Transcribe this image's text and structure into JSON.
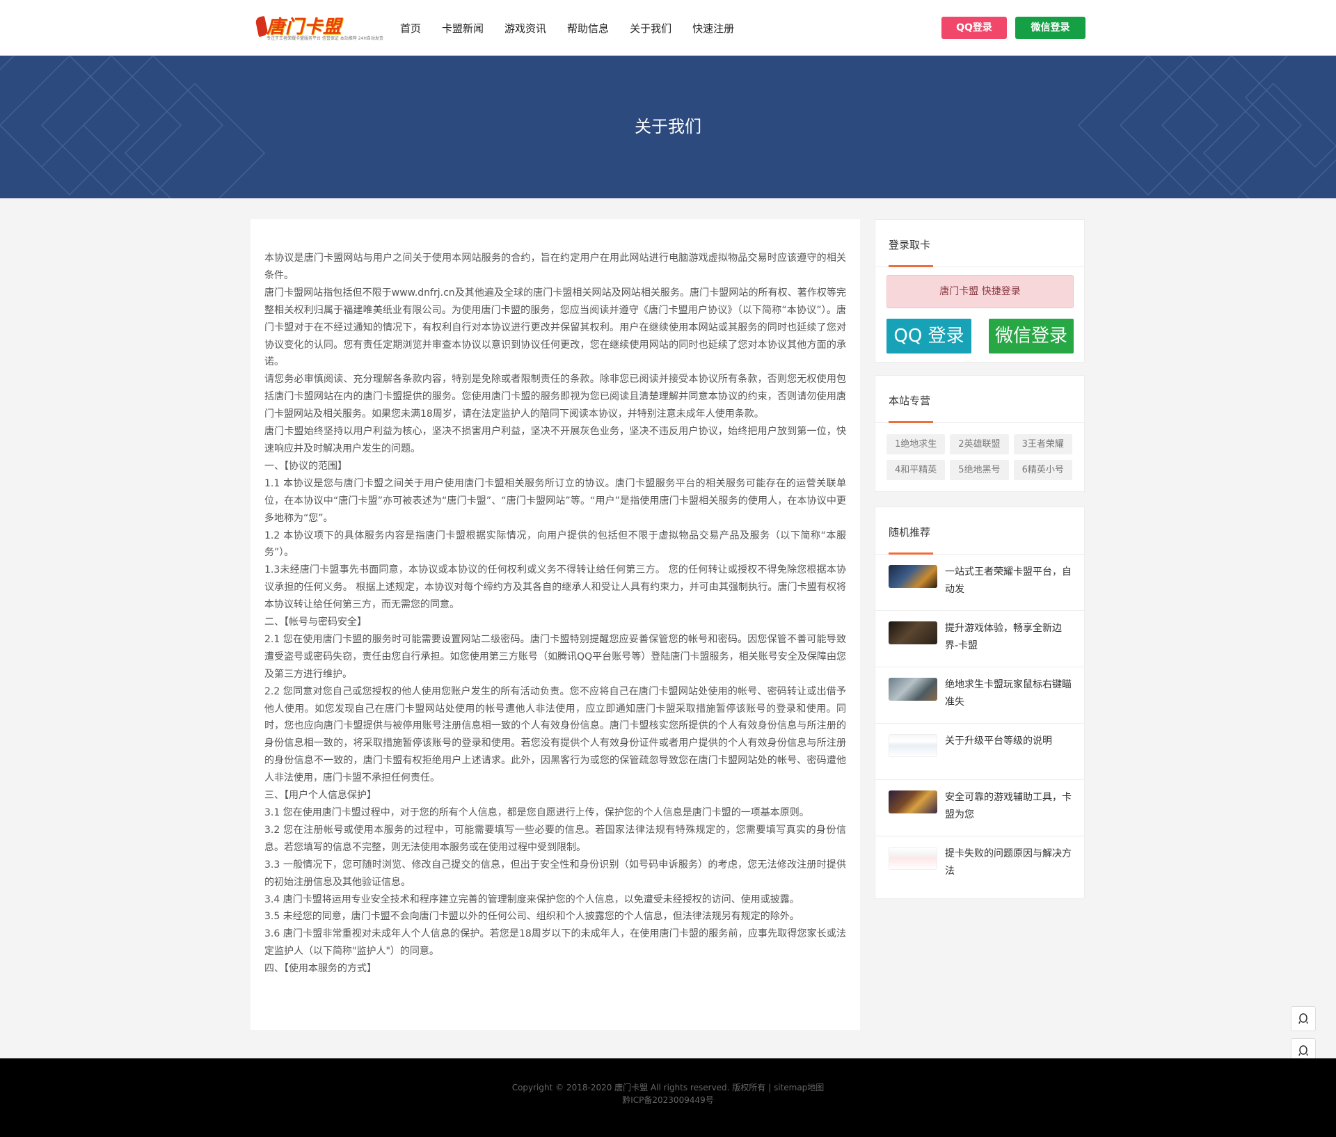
{
  "header": {
    "logo_text": "唐门卡盟",
    "logo_sub": "专注于王者荣耀卡盟服务平台 信誉保证 本站推荐 24H自动发货",
    "nav": [
      "首页",
      "卡盟新闻",
      "游戏资讯",
      "帮助信息",
      "关于我们",
      "快速注册"
    ],
    "qq_login": "QQ登录",
    "wechat_login": "微信登录"
  },
  "banner": {
    "title": "关于我们"
  },
  "article": {
    "paragraphs": [
      "本协议是唐门卡盟网站与用户之间关于使用本网站服务的合约，旨在约定用户在用此网站进行电脑游戏虚拟物品交易时应该遵守的相关条件。",
      "唐门卡盟网站指包括但不限于www.dnfrj.cn及其他遍及全球的唐门卡盟相关网站及网站相关服务。唐门卡盟网站的所有权、著作权等完整相关权利归属于福建唯美纸业有限公司。为使用唐门卡盟的服务，您应当阅读并遵守《唐门卡盟用户协议》（以下简称“本协议”）。唐门卡盟对于在不经过通知的情况下，有权利自行对本协议进行更改并保留其权利。用户在继续使用本网站或其服务的同时也延续了您对协议变化的认同。您有责任定期浏览并审查本协议以意识到协议任何更改，您在继续使用网站的同时也延续了您对本协议其他方面的承诺。",
      "请您务必审慎阅读、充分理解各条款内容，特别是免除或者限制责任的条款。除非您已阅读并接受本协议所有条款，否则您无权使用包括唐门卡盟网站在内的唐门卡盟提供的服务。您使用唐门卡盟的服务即视为您已阅读且清楚理解并同意本协议的约束，否则请勿使用唐门卡盟网站及相关服务。如果您未满18周岁，请在法定监护人的陪同下阅读本协议，并特别注意未成年人使用条款。",
      "唐门卡盟始终坚持以用户利益为核心，坚决不损害用户利益，坚决不开展灰色业务，坚决不违反用户协议，始终把用户放到第一位，快速响应并及时解决用户发生的问题。",
      "一、【协议的范围】",
      "1.1 本协议是您与唐门卡盟之间关于用户使用唐门卡盟相关服务所订立的协议。唐门卡盟服务平台的相关服务可能存在的运营关联单位，在本协议中“唐门卡盟”亦可被表述为“唐门卡盟”、“唐门卡盟网站”等。“用户”是指使用唐门卡盟相关服务的使用人，在本协议中更多地称为“您”。",
      "1.2 本协议项下的具体服务内容是指唐门卡盟根据实际情况，向用户提供的包括但不限于虚拟物品交易产品及服务（以下简称“本服务”）。",
      "1.3未经唐门卡盟事先书面同意，本协议或本协议的任何权利或义务不得转让给任何第三方。 您的任何转让或授权不得免除您根据本协议承担的任何义务。 根据上述规定，本协议对每个缔约方及其各自的继承人和受让人具有约束力，并可由其强制执行。唐门卡盟有权将本协议转让给任何第三方，而无需您的同意。",
      "二、【帐号与密码安全】",
      "2.1 您在使用唐门卡盟的服务时可能需要设置网站二级密码。唐门卡盟特别提醒您应妥善保管您的帐号和密码。因您保管不善可能导致遭受盗号或密码失窃，责任由您自行承担。如您使用第三方账号（如腾讯QQ平台账号等）登陆唐门卡盟服务，相关账号安全及保障由您及第三方进行维护。",
      "2.2 您同意对您自己或您授权的他人使用您账户发生的所有活动负责。您不应将自己在唐门卡盟网站处使用的帐号、密码转让或出借予他人使用。如您发现自己在唐门卡盟网站处使用的帐号遭他人非法使用，应立即通知唐门卡盟采取措施暂停该账号的登录和使用。同时，您也应向唐门卡盟提供与被停用账号注册信息相一致的个人有效身份信息。唐门卡盟核实您所提供的个人有效身份信息与所注册的身份信息相一致的，将采取措施暂停该账号的登录和使用。若您没有提供个人有效身份证件或者用户提供的个人有效身份信息与所注册的身份信息不一致的，唐门卡盟有权拒绝用户上述请求。此外，因黑客行为或您的保管疏忽导致您在唐门卡盟网站处的帐号、密码遭他人非法使用，唐门卡盟不承担任何责任。",
      "三、【用户个人信息保护】",
      "3.1 您在使用唐门卡盟过程中，对于您的所有个人信息，都是您自愿进行上传，保护您的个人信息是唐门卡盟的一项基本原则。",
      "3.2 您在注册帐号或使用本服务的过程中，可能需要填写一些必要的信息。若国家法律法规有特殊规定的，您需要填写真实的身份信息。若您填写的信息不完整，则无法使用本服务或在使用过程中受到限制。",
      "3.3 一般情况下，您可随时浏览、修改自己提交的信息，但出于安全性和身份识别（如号码申诉服务）的考虑，您无法修改注册时提供的初始注册信息及其他验证信息。",
      "3.4 唐门卡盟将运用专业安全技术和程序建立完善的管理制度来保护您的个人信息，以免遭受未经授权的访问、使用或披露。",
      "3.5 未经您的同意，唐门卡盟不会向唐门卡盟以外的任何公司、组织和个人披露您的个人信息，但法律法规另有规定的除外。",
      "3.6 唐门卡盟非常重视对未成年人个人信息的保护。若您是18周岁以下的未成年人，在使用唐门卡盟的服务前，应事先取得您家长或法定监护人（以下简称\"监护人\"）的同意。",
      "四、【使用本服务的方式】"
    ]
  },
  "sidebar": {
    "login_box": {
      "title": "登录取卡",
      "quick": "唐门卡盟 快捷登录",
      "qq": "QQ 登录",
      "wechat": "微信登录"
    },
    "tags_box": {
      "title": "本站专营",
      "tags": [
        "1绝地求生",
        "2英雄联盟",
        "3王者荣耀",
        "4和平精英",
        "5绝地黑号",
        "6精英小号"
      ]
    },
    "rec_box": {
      "title": "随机推荐",
      "items": [
        {
          "text": "一站式王者荣耀卡盟平台，自动发"
        },
        {
          "text": "提升游戏体验，畅享全新边界-卡盟"
        },
        {
          "text": "绝地求生卡盟玩家鼠标右键瞄准失"
        },
        {
          "text": "关于升级平台等级的说明"
        },
        {
          "text": "安全可靠的游戏辅助工具，卡盟为您"
        },
        {
          "text": "提卡失败的问题原因与解决方法"
        }
      ]
    }
  },
  "footer": {
    "copyright": "Copyright © 2018-2020 唐门卡盟 All rights reserved. 版权所有 | sitemap地图",
    "icp": "黔ICP备2023009449号"
  },
  "colors": {
    "banner": "#2c4a7e",
    "qq_top": "#f0476b",
    "wechat_top": "#16a046",
    "accent_line": "#f06c3c"
  }
}
